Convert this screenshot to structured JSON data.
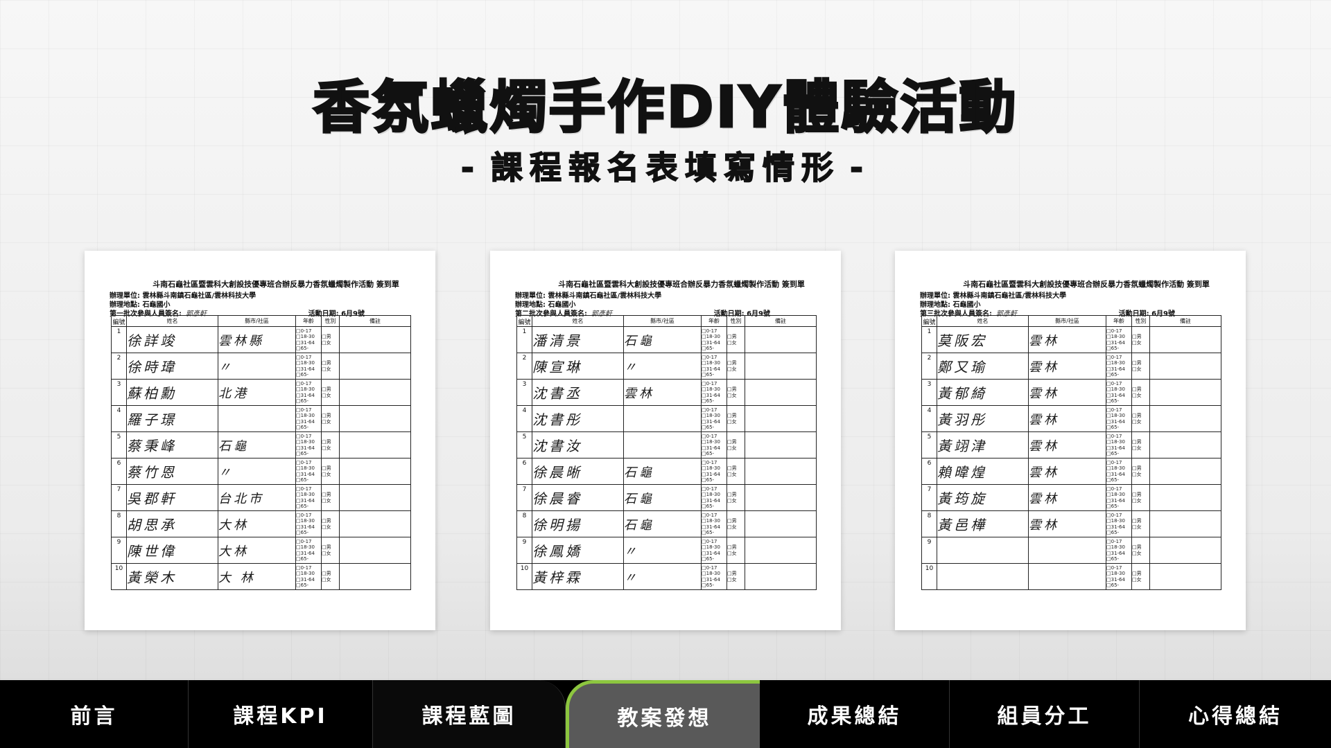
{
  "header": {
    "title": "香氛蠟燭手作DIY體驗活動",
    "subtitle_left_dash": "-",
    "subtitle": "課程報名表填寫情形",
    "subtitle_right_dash": "-"
  },
  "sheet_common": {
    "heading": "斗南石龜社區暨雲科大創設技優專班合辦反暴力香氛蠟燭製作活動 簽到單",
    "organizer": "辦理單位: 雲林縣斗南鎮石龜社區/雲林科技大學",
    "venue": "辦理地點: 石龜國小",
    "date": "活動日期: 6月9號",
    "columns": [
      "編號",
      "姓名",
      "縣市/社區",
      "年齡",
      "性別",
      "備註"
    ],
    "age_options": "□0-17\n□18-30\n□31-64\n□65-",
    "sex_options": "□男\n□女"
  },
  "sheets": [
    {
      "batch_line": "第一批次參與人員簽名:",
      "signer": "郭彥軒",
      "rows": [
        {
          "no": "1",
          "name": "徐詳竣",
          "area": "雲林縣"
        },
        {
          "no": "2",
          "name": "徐時瑋",
          "area": "〃"
        },
        {
          "no": "3",
          "name": "蘇柏勳",
          "area": "北港"
        },
        {
          "no": "4",
          "name": "羅子璟",
          "area": ""
        },
        {
          "no": "5",
          "name": "蔡秉峰",
          "area": "石龜"
        },
        {
          "no": "6",
          "name": "蔡竹恩",
          "area": "〃"
        },
        {
          "no": "7",
          "name": "吳郡軒",
          "area": "台北市"
        },
        {
          "no": "8",
          "name": "胡思承",
          "area": "大林"
        },
        {
          "no": "9",
          "name": "陳世偉",
          "area": "大林"
        },
        {
          "no": "10",
          "name": "黃榮木",
          "area": "大 林"
        }
      ]
    },
    {
      "batch_line": "第二批次參與人員簽名:",
      "signer": "郭彥軒",
      "rows": [
        {
          "no": "1",
          "name": "潘清景",
          "area": "石龜"
        },
        {
          "no": "2",
          "name": "陳宣琳",
          "area": "〃"
        },
        {
          "no": "3",
          "name": "沈書丞",
          "area": "雲林"
        },
        {
          "no": "4",
          "name": "沈書彤",
          "area": ""
        },
        {
          "no": "5",
          "name": "沈書汝",
          "area": ""
        },
        {
          "no": "6",
          "name": "徐晨晰",
          "area": "石龜"
        },
        {
          "no": "7",
          "name": "徐晨睿",
          "area": "石龜"
        },
        {
          "no": "8",
          "name": "徐明揚",
          "area": "石龜"
        },
        {
          "no": "9",
          "name": "徐鳳嬌",
          "area": "〃"
        },
        {
          "no": "10",
          "name": "黃梓霖",
          "area": "〃"
        }
      ]
    },
    {
      "batch_line": "第三批次參與人員簽名:",
      "signer": "郭彥軒",
      "rows": [
        {
          "no": "1",
          "name": "莫阪宏",
          "area": "雲林"
        },
        {
          "no": "2",
          "name": "鄭又瑜",
          "area": "雲林"
        },
        {
          "no": "3",
          "name": "黃郁綺",
          "area": "雲林"
        },
        {
          "no": "4",
          "name": "黃羽彤",
          "area": "雲林"
        },
        {
          "no": "5",
          "name": "黃翊津",
          "area": "雲林"
        },
        {
          "no": "6",
          "name": "賴暐煌",
          "area": "雲林"
        },
        {
          "no": "7",
          "name": "黃筠旋",
          "area": "雲林"
        },
        {
          "no": "8",
          "name": "黃邑樺",
          "area": "雲林"
        },
        {
          "no": "9",
          "name": "",
          "area": ""
        },
        {
          "no": "10",
          "name": "",
          "area": ""
        }
      ]
    }
  ],
  "nav": {
    "tabs": [
      {
        "label": "前言"
      },
      {
        "label": "課程KPI"
      },
      {
        "label": "課程藍圖"
      },
      {
        "label": "教案發想"
      },
      {
        "label": "成果總結"
      },
      {
        "label": "組員分工"
      },
      {
        "label": "心得總結"
      }
    ],
    "active_index": 3,
    "active_color": "#595959",
    "accent_color": "#8dc63f"
  }
}
